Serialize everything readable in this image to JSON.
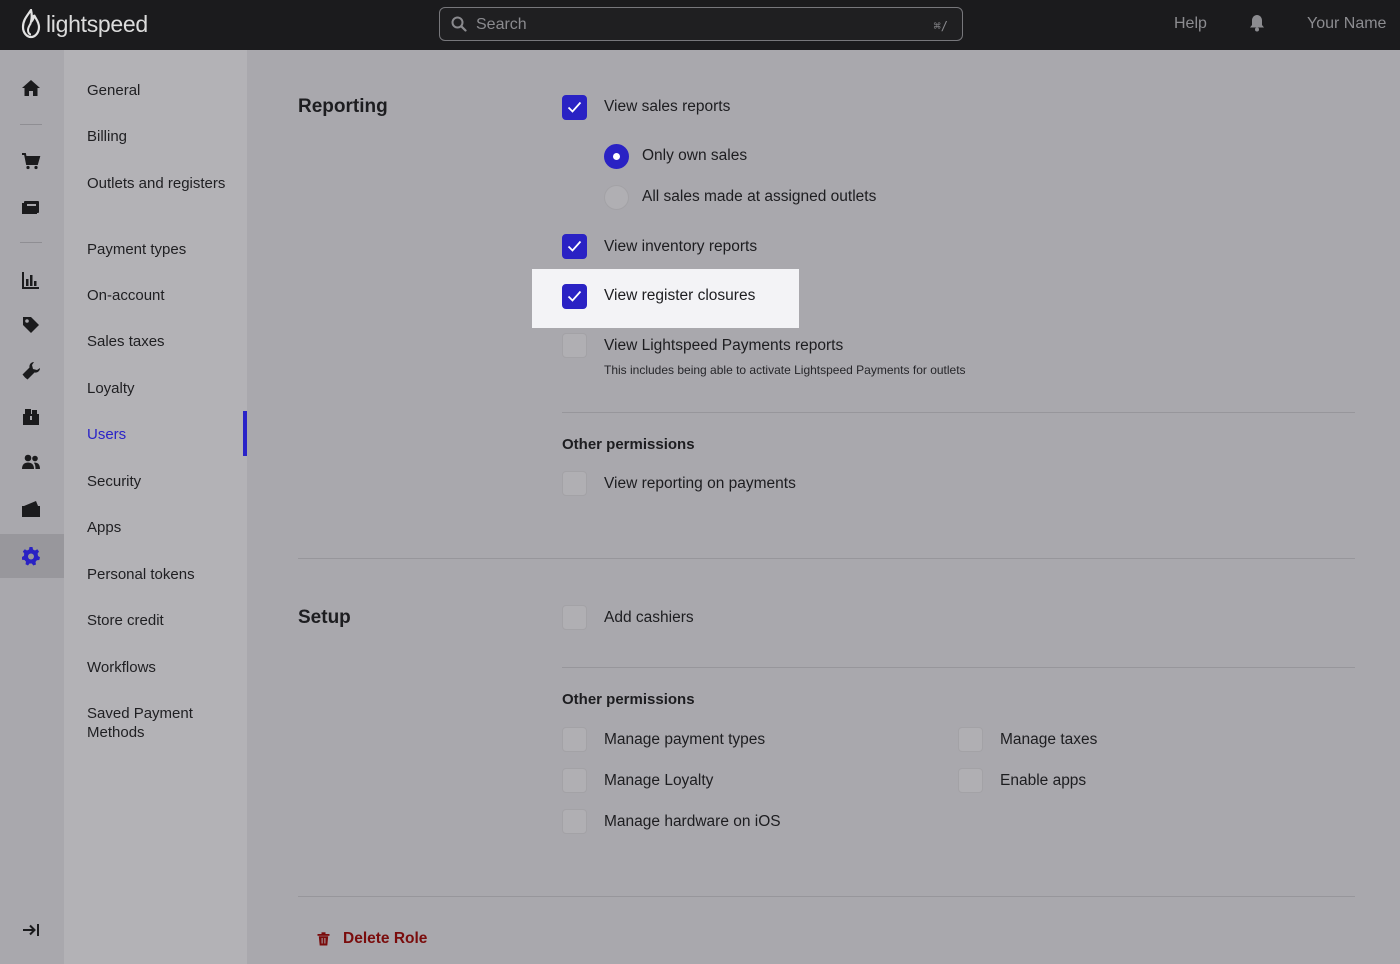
{
  "brand": {
    "name": "lightspeed"
  },
  "topbar": {
    "search_placeholder": "Search",
    "search_shortcut": "⌘/",
    "help_label": "Help",
    "user_name": "Your Name"
  },
  "rail": {
    "icons": [
      "home-icon",
      "cart-icon",
      "register-icon",
      "reports-icon",
      "tag-icon",
      "wrench-icon",
      "inventory-icon",
      "customers-icon",
      "ecommerce-icon",
      "settings-icon",
      "collapse-icon"
    ],
    "active": "settings-icon"
  },
  "subnav": {
    "items": [
      "General",
      "Billing",
      "Outlets and registers",
      "Payment types",
      "On-account",
      "Sales taxes",
      "Loyalty",
      "Users",
      "Security",
      "Apps",
      "Personal tokens",
      "Store credit",
      "Workflows",
      "Saved Payment Methods"
    ],
    "active": "Users"
  },
  "reporting": {
    "title": "Reporting",
    "view_sales_reports": {
      "label": "View sales reports",
      "checked": true
    },
    "sales_scope": {
      "options": [
        "Only own sales",
        "All sales made at assigned outlets"
      ],
      "selected": "Only own sales"
    },
    "view_inventory_reports": {
      "label": "View inventory reports",
      "checked": true
    },
    "view_register_closures": {
      "label": "View register closures",
      "checked": true
    },
    "view_lightspeed_payments": {
      "label": "View Lightspeed Payments reports",
      "hint": "This includes being able to activate Lightspeed Payments for outlets",
      "checked": false
    },
    "other_permissions": {
      "title": "Other permissions",
      "view_reporting_on_payments": {
        "label": "View reporting on payments",
        "checked": false
      }
    }
  },
  "setup": {
    "title": "Setup",
    "add_cashiers": {
      "label": "Add cashiers",
      "checked": false
    },
    "other_permissions": {
      "title": "Other permissions",
      "manage_payment_types": {
        "label": "Manage payment types",
        "checked": false
      },
      "manage_taxes": {
        "label": "Manage taxes",
        "checked": false
      },
      "manage_loyalty": {
        "label": "Manage Loyalty",
        "checked": false
      },
      "enable_apps": {
        "label": "Enable apps",
        "checked": false
      },
      "manage_hardware_ios": {
        "label": "Manage hardware on iOS",
        "checked": false
      }
    }
  },
  "actions": {
    "delete_role": "Delete Role"
  },
  "colors": {
    "accent": "#2a22c4",
    "danger": "#7a0c0c",
    "topbar": "#1b1b1d"
  }
}
